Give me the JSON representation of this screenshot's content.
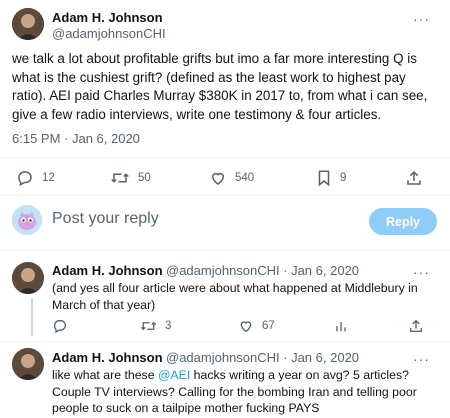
{
  "main_tweet": {
    "author_name": "Adam H. Johnson",
    "author_handle": "@adamjohnsonCHI",
    "more_label": "···",
    "text": "we talk a lot about profitable grifts but imo a far more interesting Q is what is the cushiest grift? (defined as the least work to highest pay ratio). AEI paid Charles Murray $380K in 2017 to, from what i can see, give a few radio interviews, write one testimony & four articles.",
    "timestamp": "6:15 PM · Jan 6, 2020",
    "stats": {
      "replies": "12",
      "retweets": "50",
      "likes": "540",
      "bookmarks": "9"
    }
  },
  "composer": {
    "placeholder": "Post your reply",
    "button_label": "Reply"
  },
  "replies": [
    {
      "author_name": "Adam H. Johnson",
      "author_handle": "@adamjohnsonCHI",
      "date": "· Jan 6, 2020",
      "more_label": "···",
      "text": "(and yes all four article were about what happened at Middlebury in March of that year)",
      "stats": {
        "replies": "",
        "retweets": "3",
        "likes": "67"
      }
    },
    {
      "author_name": "Adam H. Johnson",
      "author_handle": "@adamjohnsonCHI",
      "date": "· Jan 6, 2020",
      "more_label": "···",
      "text_before": "like what are these ",
      "mention": "@AEI",
      "text_after": " hacks writing a year on avg? 5 articles? Couple TV interviews? Calling for the bombing Iran and telling poor people to suck on a tailpipe mother fucking PAYS"
    }
  ],
  "colors": {
    "accent": "#1d9bf0",
    "reply_button_disabled": "#8ecdf8",
    "secondary_text": "#536471"
  }
}
